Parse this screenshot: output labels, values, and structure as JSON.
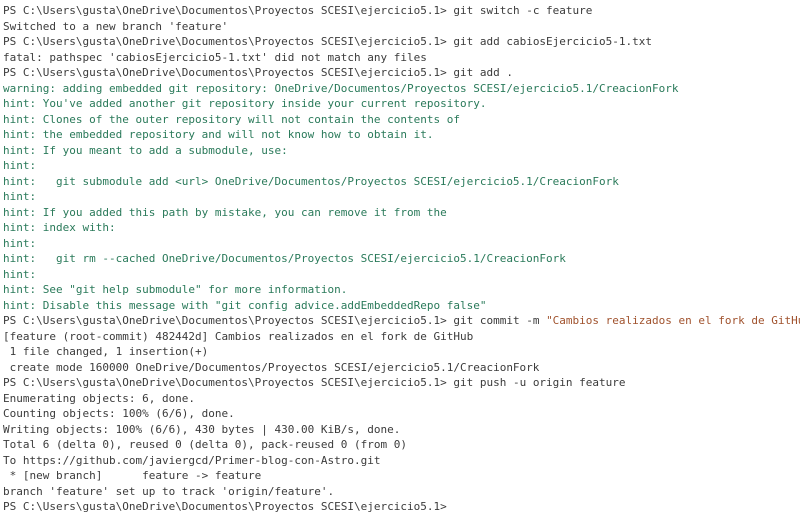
{
  "terminal": {
    "lines": [
      [
        {
          "t": "PS C:\\Users\\gusta\\OneDrive\\Documentos\\Proyectos SCESI\\ejercicio5.1> ",
          "k": "prompt"
        },
        {
          "t": "git switch -c feature",
          "k": "command"
        }
      ],
      [
        {
          "t": "Switched to a new branch 'feature'",
          "k": "normal"
        }
      ],
      [
        {
          "t": "PS C:\\Users\\gusta\\OneDrive\\Documentos\\Proyectos SCESI\\ejercicio5.1> ",
          "k": "prompt"
        },
        {
          "t": "git add cabiosEjercicio5-1.txt",
          "k": "command"
        }
      ],
      [
        {
          "t": "fatal: pathspec 'cabiosEjercicio5-1.txt' did not match any files",
          "k": "normal"
        }
      ],
      [
        {
          "t": "PS C:\\Users\\gusta\\OneDrive\\Documentos\\Proyectos SCESI\\ejercicio5.1> ",
          "k": "prompt"
        },
        {
          "t": "git add .",
          "k": "command"
        }
      ],
      [
        {
          "t": "warning: adding embedded git repository: OneDrive/Documentos/Proyectos SCESI/ejercicio5.1/CreacionFork",
          "k": "warning"
        }
      ],
      [
        {
          "t": "hint: You've added another git repository inside your current repository.",
          "k": "hint"
        }
      ],
      [
        {
          "t": "hint: Clones of the outer repository will not contain the contents of",
          "k": "hint"
        }
      ],
      [
        {
          "t": "hint: the embedded repository and will not know how to obtain it.",
          "k": "hint"
        }
      ],
      [
        {
          "t": "hint: If you meant to add a submodule, use:",
          "k": "hint"
        }
      ],
      [
        {
          "t": "hint:",
          "k": "hint"
        }
      ],
      [
        {
          "t": "hint:   git submodule add <url> OneDrive/Documentos/Proyectos SCESI/ejercicio5.1/CreacionFork",
          "k": "hint"
        }
      ],
      [
        {
          "t": "hint:",
          "k": "hint"
        }
      ],
      [
        {
          "t": "hint: If you added this path by mistake, you can remove it from the",
          "k": "hint"
        }
      ],
      [
        {
          "t": "hint: index with:",
          "k": "hint"
        }
      ],
      [
        {
          "t": "hint:",
          "k": "hint"
        }
      ],
      [
        {
          "t": "hint:   git rm --cached OneDrive/Documentos/Proyectos SCESI/ejercicio5.1/CreacionFork",
          "k": "hint"
        }
      ],
      [
        {
          "t": "hint:",
          "k": "hint"
        }
      ],
      [
        {
          "t": "hint: See \"git help submodule\" for more information.",
          "k": "hint"
        }
      ],
      [
        {
          "t": "hint: Disable this message with \"git config advice.addEmbeddedRepo false\"",
          "k": "hint"
        }
      ],
      [
        {
          "t": "PS C:\\Users\\gusta\\OneDrive\\Documentos\\Proyectos SCESI\\ejercicio5.1> ",
          "k": "prompt"
        },
        {
          "t": "git commit -m ",
          "k": "command"
        },
        {
          "t": "\"Cambios realizados en el fork de GitHub\"",
          "k": "string"
        }
      ],
      [
        {
          "t": "[feature (root-commit) 482442d] Cambios realizados en el fork de GitHub",
          "k": "normal"
        }
      ],
      [
        {
          "t": " 1 file changed, 1 insertion(+)",
          "k": "normal"
        }
      ],
      [
        {
          "t": " create mode 160000 OneDrive/Documentos/Proyectos SCESI/ejercicio5.1/CreacionFork",
          "k": "normal"
        }
      ],
      [
        {
          "t": "PS C:\\Users\\gusta\\OneDrive\\Documentos\\Proyectos SCESI\\ejercicio5.1> ",
          "k": "prompt"
        },
        {
          "t": "git push -u origin feature",
          "k": "command"
        }
      ],
      [
        {
          "t": "Enumerating objects: 6, done.",
          "k": "normal"
        }
      ],
      [
        {
          "t": "Counting objects: 100% (6/6), done.",
          "k": "normal"
        }
      ],
      [
        {
          "t": "Writing objects: 100% (6/6), 430 bytes | 430.00 KiB/s, done.",
          "k": "normal"
        }
      ],
      [
        {
          "t": "Total 6 (delta 0), reused 0 (delta 0), pack-reused 0 (from 0)",
          "k": "normal"
        }
      ],
      [
        {
          "t": "To https://github.com/javiergcd/Primer-blog-con-Astro.git",
          "k": "normal"
        }
      ],
      [
        {
          "t": " * [new branch]      feature -> feature",
          "k": "normal"
        }
      ],
      [
        {
          "t": "branch 'feature' set up to track 'origin/feature'.",
          "k": "normal"
        }
      ],
      [
        {
          "t": "PS C:\\Users\\gusta\\OneDrive\\Documentos\\Proyectos SCESI\\ejercicio5.1> ",
          "k": "prompt"
        }
      ]
    ]
  },
  "colors": {
    "background": "#ffffff",
    "text": "#3b3b3b",
    "hint": "#2a7a5a",
    "string": "#a0522d"
  }
}
